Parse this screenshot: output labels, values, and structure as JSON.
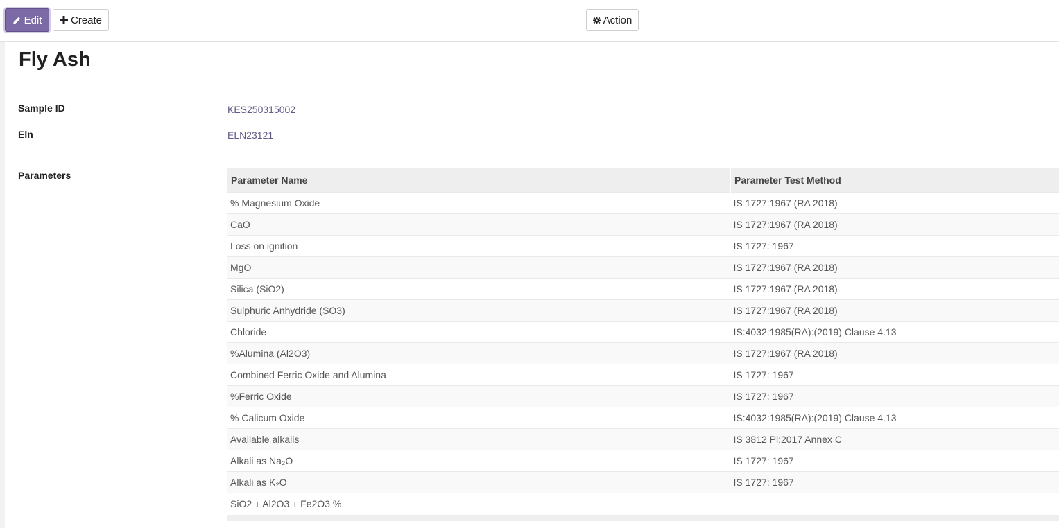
{
  "toolbar": {
    "edit_label": "Edit",
    "create_label": "Create",
    "action_label": "Action",
    "edit_icon": "pencil-icon",
    "create_icon": "plus-icon",
    "action_icon": "gear-icon",
    "accent_color": "#7c6aa6"
  },
  "record": {
    "title": "Fly Ash",
    "fields": {
      "sample_id_label": "Sample ID",
      "sample_id_value": "KES250315002",
      "eln_label": "Eln",
      "eln_value": "ELN23121",
      "parameters_label": "Parameters"
    }
  },
  "parameters_table": {
    "headers": [
      "Parameter Name",
      "Parameter Test Method"
    ],
    "rows": [
      [
        "% Magnesium Oxide",
        "IS 1727:1967 (RA 2018)"
      ],
      [
        "CaO",
        "IS 1727:1967 (RA 2018)"
      ],
      [
        "Loss on ignition",
        "IS 1727: 1967"
      ],
      [
        "MgO",
        "IS 1727:1967 (RA 2018)"
      ],
      [
        "Silica (SiO2)",
        "IS 1727:1967 (RA 2018)"
      ],
      [
        "Sulphuric Anhydride (SO3)",
        "IS 1727:1967 (RA 2018)"
      ],
      [
        "Chloride",
        "IS:4032:1985(RA):(2019) Clause 4.13"
      ],
      [
        "%Alumina (Al2O3)",
        "IS 1727:1967 (RA 2018)"
      ],
      [
        "Combined Ferric Oxide and Alumina",
        "IS 1727: 1967"
      ],
      [
        "%Ferric Oxide",
        "IS 1727: 1967"
      ],
      [
        "% Calicum Oxide",
        "IS:4032:1985(RA):(2019) Clause 4.13"
      ],
      [
        "Available alkalis",
        "IS 3812 Pl:2017 Annex C"
      ],
      [
        "Alkali as Na₂O",
        "IS 1727: 1967"
      ],
      [
        "Alkali as K₂O",
        "IS 1727: 1967"
      ],
      [
        "SiO2 + Al2O3 + Fe2O3 %",
        ""
      ]
    ]
  }
}
